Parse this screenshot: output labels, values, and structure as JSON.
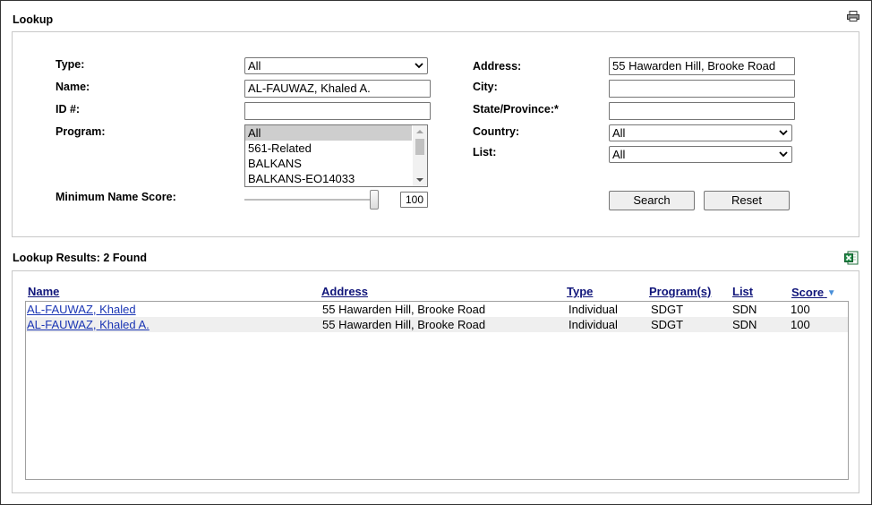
{
  "lookup": {
    "title": "Lookup",
    "labels": {
      "type": "Type:",
      "name": "Name:",
      "id": "ID #:",
      "program": "Program:",
      "min_score": "Minimum Name Score:",
      "address": "Address:",
      "city": "City:",
      "state": "State/Province:*",
      "country": "Country:",
      "list": "List:"
    },
    "values": {
      "type": "All",
      "name": "AL-FAUWAZ, Khaled A.",
      "id": "",
      "address": "55 Hawarden Hill, Brooke Road",
      "city": "",
      "state": "",
      "country": "All",
      "list": "All",
      "min_score": "100"
    },
    "min_score_level": 1.0,
    "program_options": [
      "All",
      "561-Related",
      "BALKANS",
      "BALKANS-EO14033"
    ],
    "program_selected": "All",
    "buttons": {
      "search": "Search",
      "reset": "Reset"
    }
  },
  "results": {
    "title": "Lookup Results: 2 Found",
    "columns": [
      "Name",
      "Address",
      "Type",
      "Program(s)",
      "List",
      "Score"
    ],
    "sort_indicator": "▼",
    "rows": [
      {
        "name": "AL-FAUWAZ, Khaled",
        "address": "55 Hawarden Hill, Brooke Road",
        "type": "Individual",
        "program": "SDGT",
        "list": "SDN",
        "score": "100"
      },
      {
        "name": "AL-FAUWAZ, Khaled A.",
        "address": "55 Hawarden Hill, Brooke Road",
        "type": "Individual",
        "program": "SDGT",
        "list": "SDN",
        "score": "100"
      }
    ]
  },
  "icons": {
    "print": "printer-icon",
    "export": "excel-export-icon"
  },
  "colors": {
    "header_link": "#10157a",
    "row_link": "#1a35b4",
    "row_alt": "#efefef",
    "sort_arrow": "#4a90d9"
  }
}
